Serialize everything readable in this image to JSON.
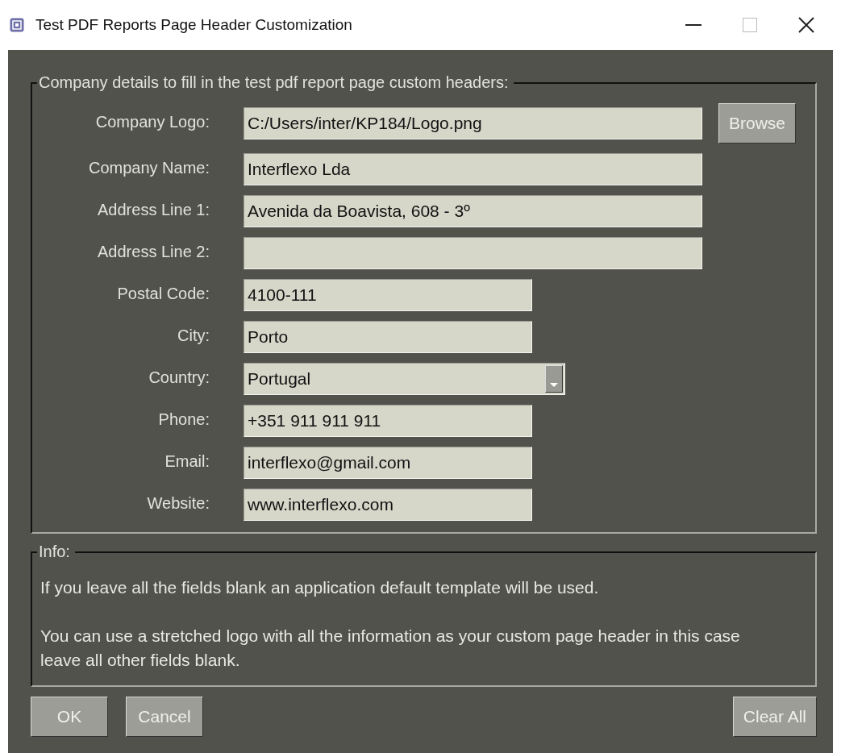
{
  "window": {
    "title": "Test PDF Reports Page Header Customization"
  },
  "company_group": {
    "legend": "Company details to fill in the test pdf report page custom headers:",
    "rows": [
      {
        "label": "Company Logo:",
        "kind": "wide",
        "value": "C:/Users/inter/KP184/Logo.png",
        "button": "Browse"
      },
      {
        "label": "Company Name:",
        "kind": "wide",
        "value": "Interflexo Lda"
      },
      {
        "label": "Address Line 1:",
        "kind": "wide",
        "value": "Avenida da Boavista, 608 - 3º"
      },
      {
        "label": "Address Line 2:",
        "kind": "wide"
      },
      {
        "label": "Postal Code:",
        "kind": "short",
        "value": "4100-111"
      },
      {
        "label": "City:",
        "kind": "short",
        "value": "Porto"
      },
      {
        "label": "Country:",
        "kind": "dropdown",
        "value": "Portugal"
      },
      {
        "label": "Phone:",
        "kind": "short",
        "value": "+351 911 911 911"
      },
      {
        "label": "Email:",
        "kind": "short",
        "value": "interflexo@gmail.com"
      },
      {
        "label": "Website:",
        "kind": "short",
        "value": "www.interflexo.com"
      }
    ]
  },
  "info_group": {
    "legend": "Info:",
    "paragraphs": [
      "If you leave all the fields blank an application default template will be used.",
      "You can use a stretched logo with all the information as your custom page header in this case leave all other fields blank."
    ]
  },
  "buttons_left": [
    "OK",
    "Cancel"
  ],
  "buttons_right": [
    "Clear All"
  ]
}
